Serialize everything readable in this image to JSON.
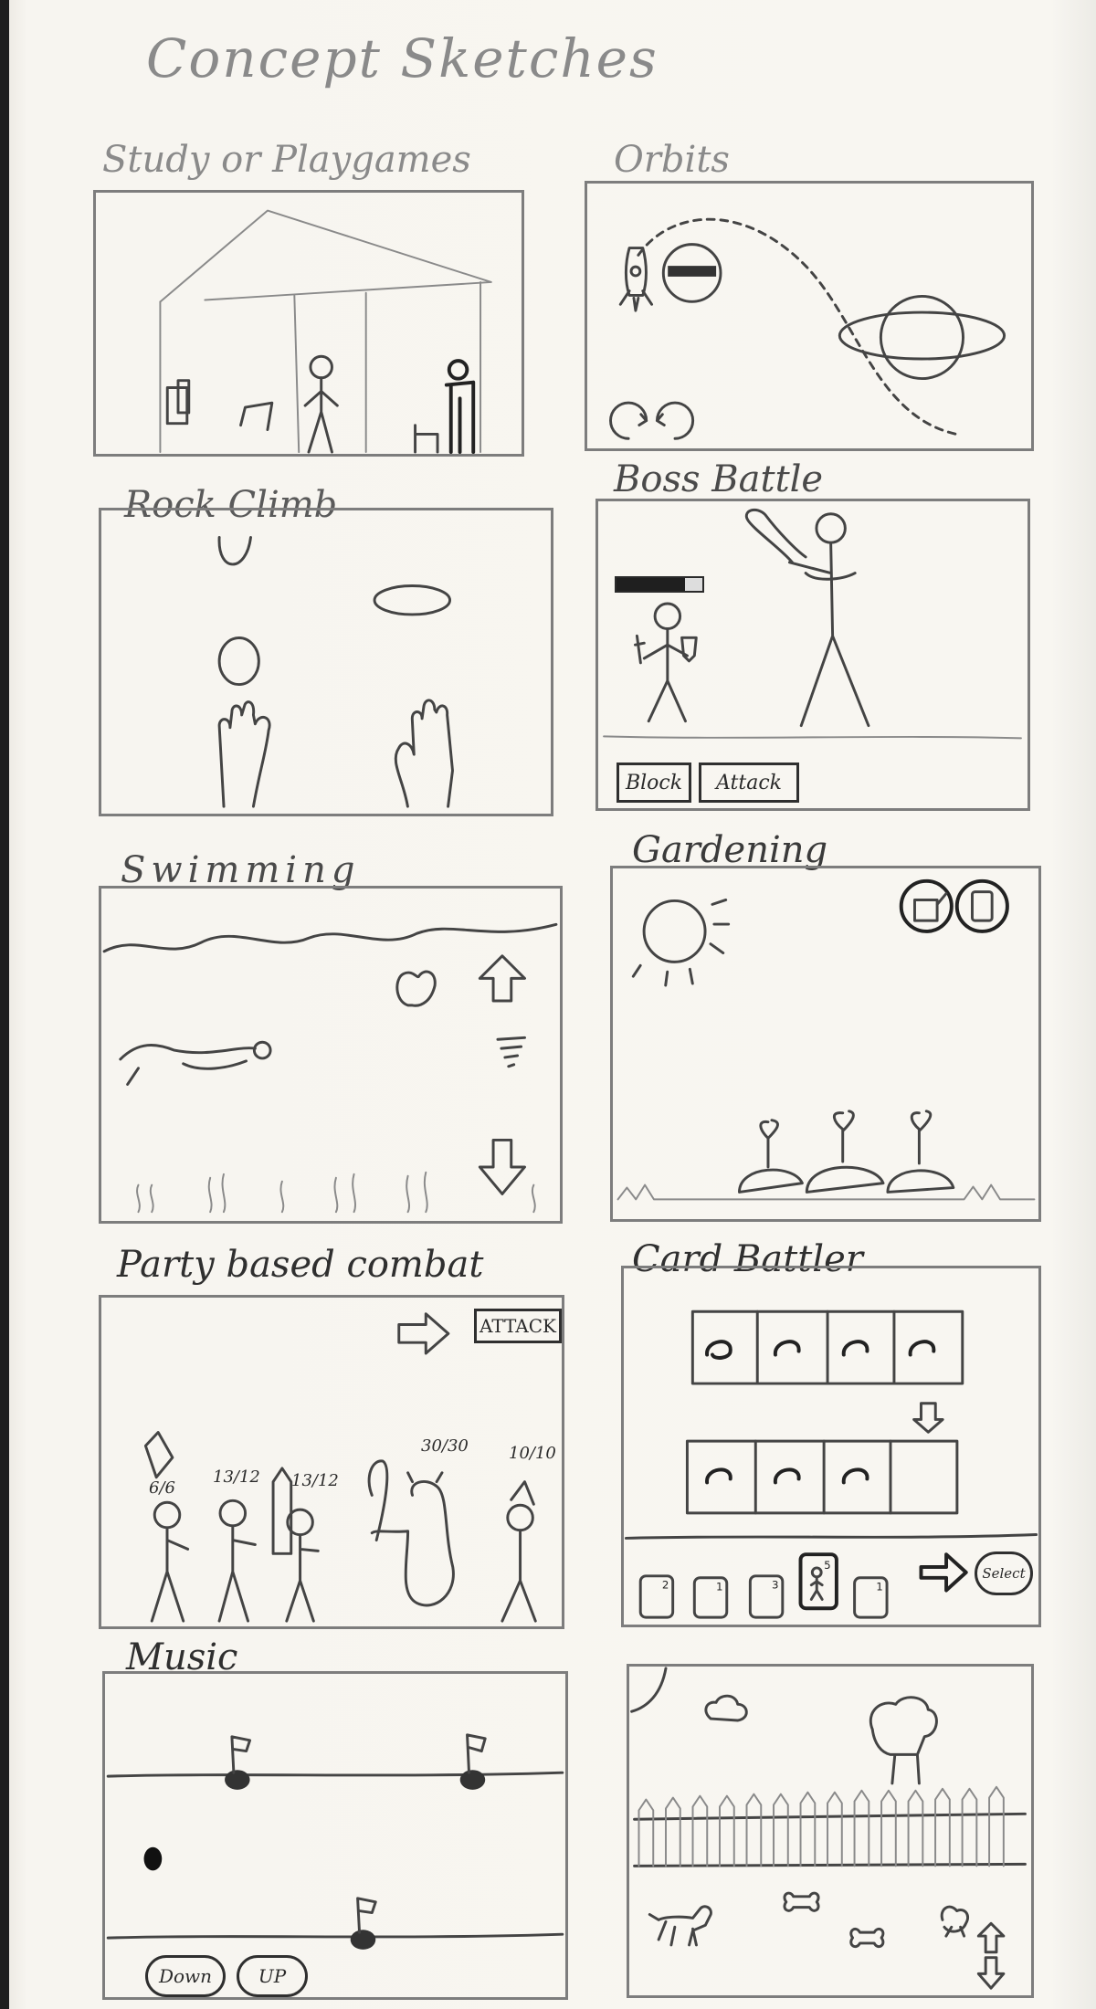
{
  "page": {
    "title": "Concept Sketches"
  },
  "panels": {
    "study": {
      "label": "Study or Playgames"
    },
    "orbits": {
      "label": "Orbits"
    },
    "rock": {
      "label": "Rock Climb"
    },
    "boss": {
      "label": "Boss Battle",
      "block_label": "Block",
      "attack_label": "Attack",
      "player_health_fraction": 0.8
    },
    "swimming": {
      "label": "Swimming"
    },
    "gardening": {
      "label": "Gardening"
    },
    "party": {
      "label": "Party based combat",
      "attack_label": "ATTACK",
      "hero_stats": [
        "6/6",
        "13/12",
        "13/12"
      ],
      "enemy_stats": [
        "30/30",
        "10/10"
      ]
    },
    "card": {
      "label": "Card Battler",
      "select_label": "Select",
      "hand_costs": [
        "2",
        "1",
        "3",
        "5",
        "1"
      ]
    },
    "music": {
      "label": "Music",
      "down_label": "Down",
      "up_label": "UP"
    },
    "backyard": {
      "label": ""
    }
  },
  "icons": {
    "rocket": "rocket-icon",
    "rotate_left": "rotate-left-icon",
    "rotate_right": "rotate-right-icon",
    "up_arrow": "arrow-up-icon",
    "down_arrow": "arrow-down-icon",
    "right_arrow": "arrow-right-icon",
    "glove": "glove-icon",
    "tornado": "tornado-icon",
    "watering_can": "watering-can-icon",
    "seed_packet": "seed-packet-icon"
  }
}
